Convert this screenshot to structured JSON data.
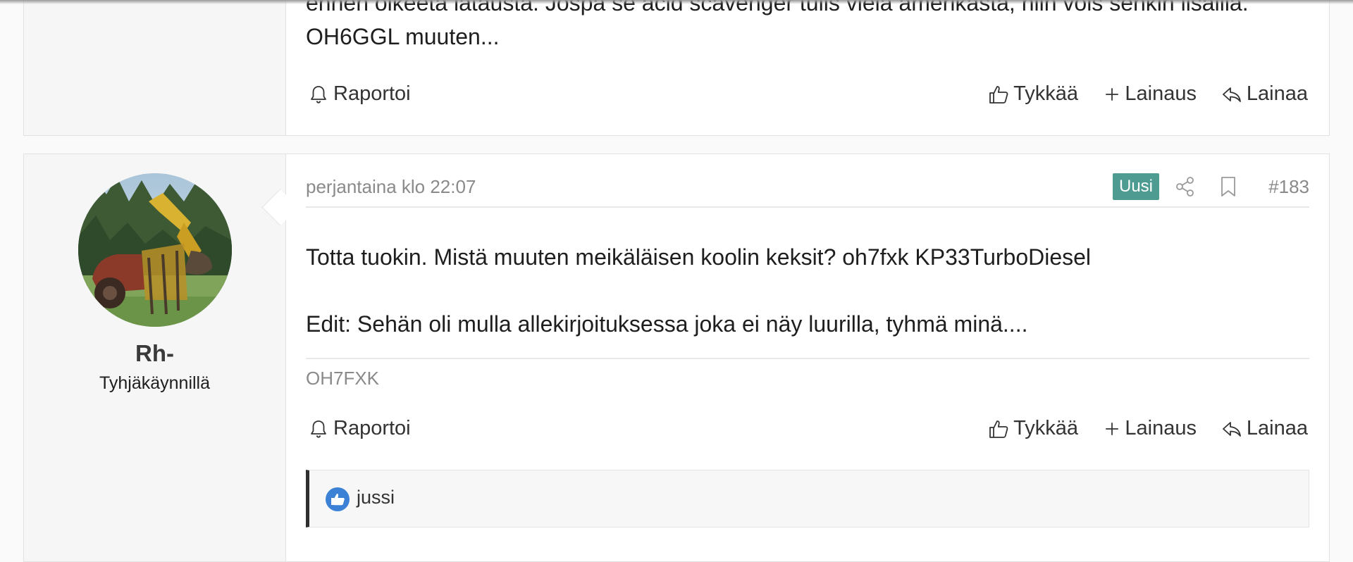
{
  "posts": [
    {
      "body": [
        "ennen oikeeta latausta. Jospa se acid scavenger tulis vielä amerikasta, niin vois senkin lisäillä.",
        "OH6GGL muuten..."
      ],
      "actions": {
        "report": "Raportoi",
        "like": "Tykkää",
        "multiquote": "Lainaus",
        "reply": "Lainaa"
      }
    },
    {
      "author": {
        "name": "Rh-",
        "title": "Tyhjäkäynnillä"
      },
      "date": "perjantaina klo 22:07",
      "badge": "Uusi",
      "post_number": "#183",
      "body": [
        "Totta tuokin. Mistä muuten meikäläisen koolin keksit? oh7fxk KP33TurboDiesel",
        "Edit: Sehän oli mulla allekirjoituksessa joka ei näy luurilla, tyhmä minä...."
      ],
      "signature": "OH7FXK",
      "actions": {
        "report": "Raportoi",
        "like": "Tykkää",
        "multiquote": "Lainaus",
        "reply": "Lainaa"
      },
      "likes": [
        "jussi"
      ]
    }
  ],
  "colors": {
    "badge": "#4e9b91",
    "like_icon": "#3b82d6"
  }
}
